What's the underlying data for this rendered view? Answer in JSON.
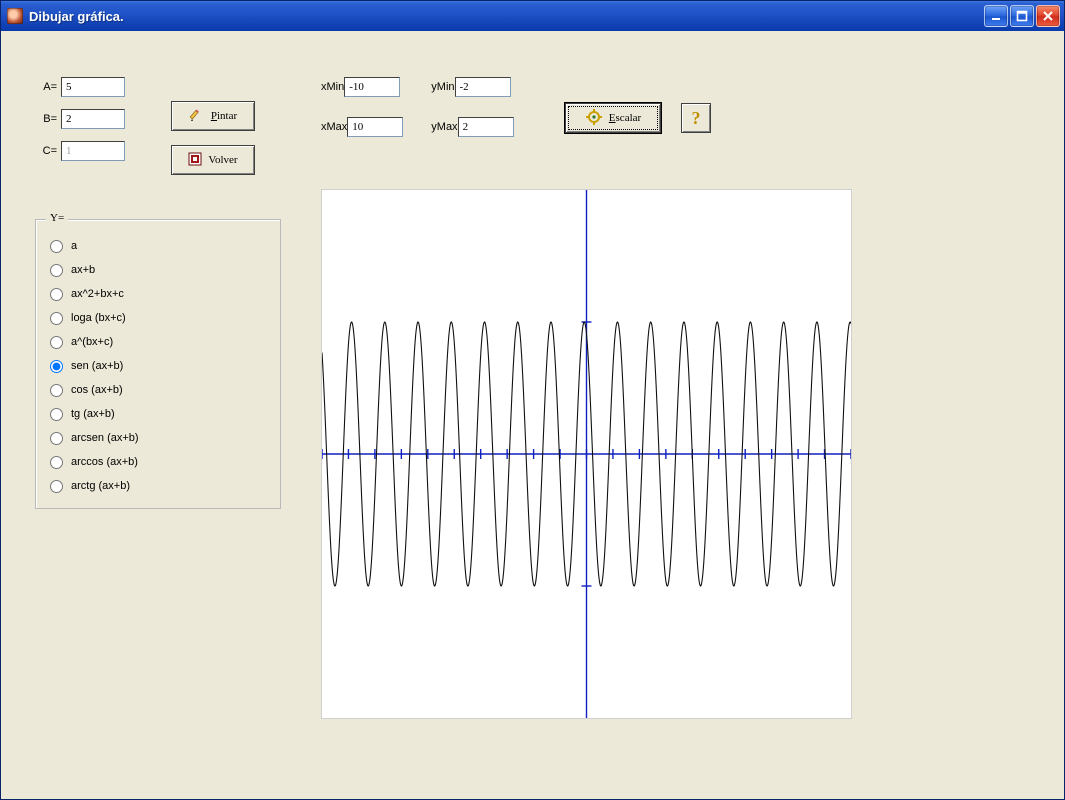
{
  "window": {
    "title": "Dibujar gráfica."
  },
  "params": {
    "a_label": "A=",
    "a_value": "5",
    "b_label": "B=",
    "b_value": "2",
    "c_label": "C=",
    "c_value": "1",
    "c_disabled": true
  },
  "buttons": {
    "pintar": "Pintar",
    "volver": "Volver",
    "escalar": "Escalar"
  },
  "range": {
    "xmin_label": "xMin",
    "xmin_value": "-10",
    "xmax_label": "xMax",
    "xmax_value": "10",
    "ymin_label": "yMin",
    "ymin_value": "-2",
    "ymax_label": "yMax",
    "ymax_value": "2"
  },
  "functions": {
    "legend": "Y=",
    "selected": "sen",
    "options": [
      {
        "id": "a",
        "label": "a"
      },
      {
        "id": "axb",
        "label": "ax+b"
      },
      {
        "id": "quad",
        "label": "ax^2+bx+c"
      },
      {
        "id": "loga",
        "label": "loga (bx+c)"
      },
      {
        "id": "apow",
        "label": "a^(bx+c)"
      },
      {
        "id": "sen",
        "label": "sen (ax+b)"
      },
      {
        "id": "cos",
        "label": "cos (ax+b)"
      },
      {
        "id": "tg",
        "label": "tg (ax+b)"
      },
      {
        "id": "arcsen",
        "label": "arcsen (ax+b)"
      },
      {
        "id": "arccos",
        "label": "arccos (ax+b)"
      },
      {
        "id": "arctg",
        "label": "arctg (ax+b)"
      }
    ]
  },
  "chart_data": {
    "type": "line",
    "function": "sin(a*x + b)",
    "a": 5,
    "b": 2,
    "xmin": -10,
    "xmax": 10,
    "ymin": -2,
    "ymax": 2,
    "x_ticks": [
      -10,
      -9,
      -8,
      -7,
      -6,
      -5,
      -4,
      -3,
      -2,
      -1,
      0,
      1,
      2,
      3,
      4,
      5,
      6,
      7,
      8,
      9,
      10
    ],
    "axis_color": "#1020c0",
    "curve_color": "#101010"
  }
}
